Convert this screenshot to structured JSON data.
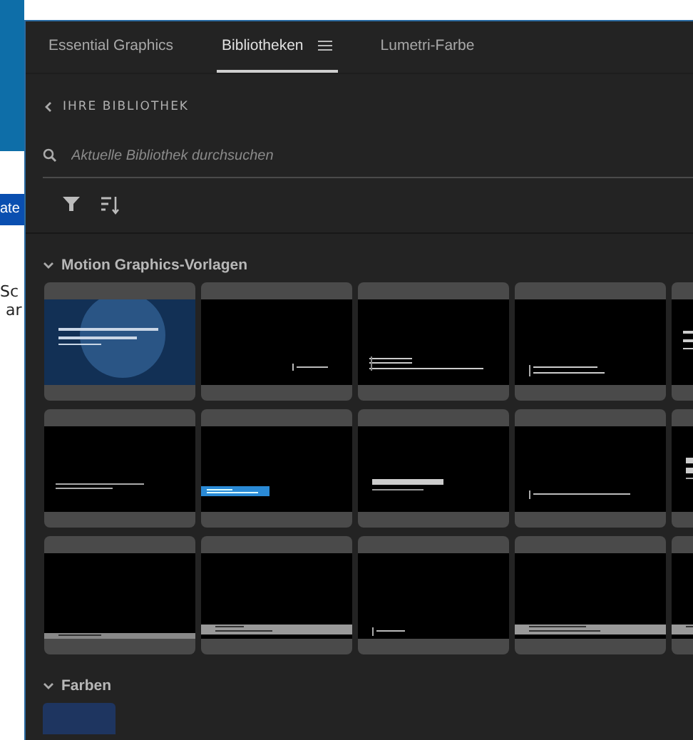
{
  "background_window": {
    "texts": [
      {
        "kind": "button",
        "text": "ate"
      },
      {
        "kind": "label",
        "text": "Sc"
      },
      {
        "kind": "label",
        "text": "ar"
      }
    ]
  },
  "tabs": [
    {
      "label": "Essential Graphics",
      "selected": false,
      "menu": false
    },
    {
      "label": "Bibliotheken",
      "selected": true,
      "menu": true
    },
    {
      "label": "Lumetri-Farbe",
      "selected": false,
      "menu": false
    }
  ],
  "back_link": "IHRE BIBLIOTHEK",
  "search": {
    "placeholder": "Aktuelle Bibliothek durchsuchen"
  },
  "sections": [
    {
      "title": "Motion Graphics-Vorlagen",
      "expanded": true,
      "kind": "templates"
    },
    {
      "title": "Farben",
      "expanded": true,
      "kind": "colors",
      "items": [
        {
          "color": "#1e3560"
        }
      ]
    }
  ]
}
